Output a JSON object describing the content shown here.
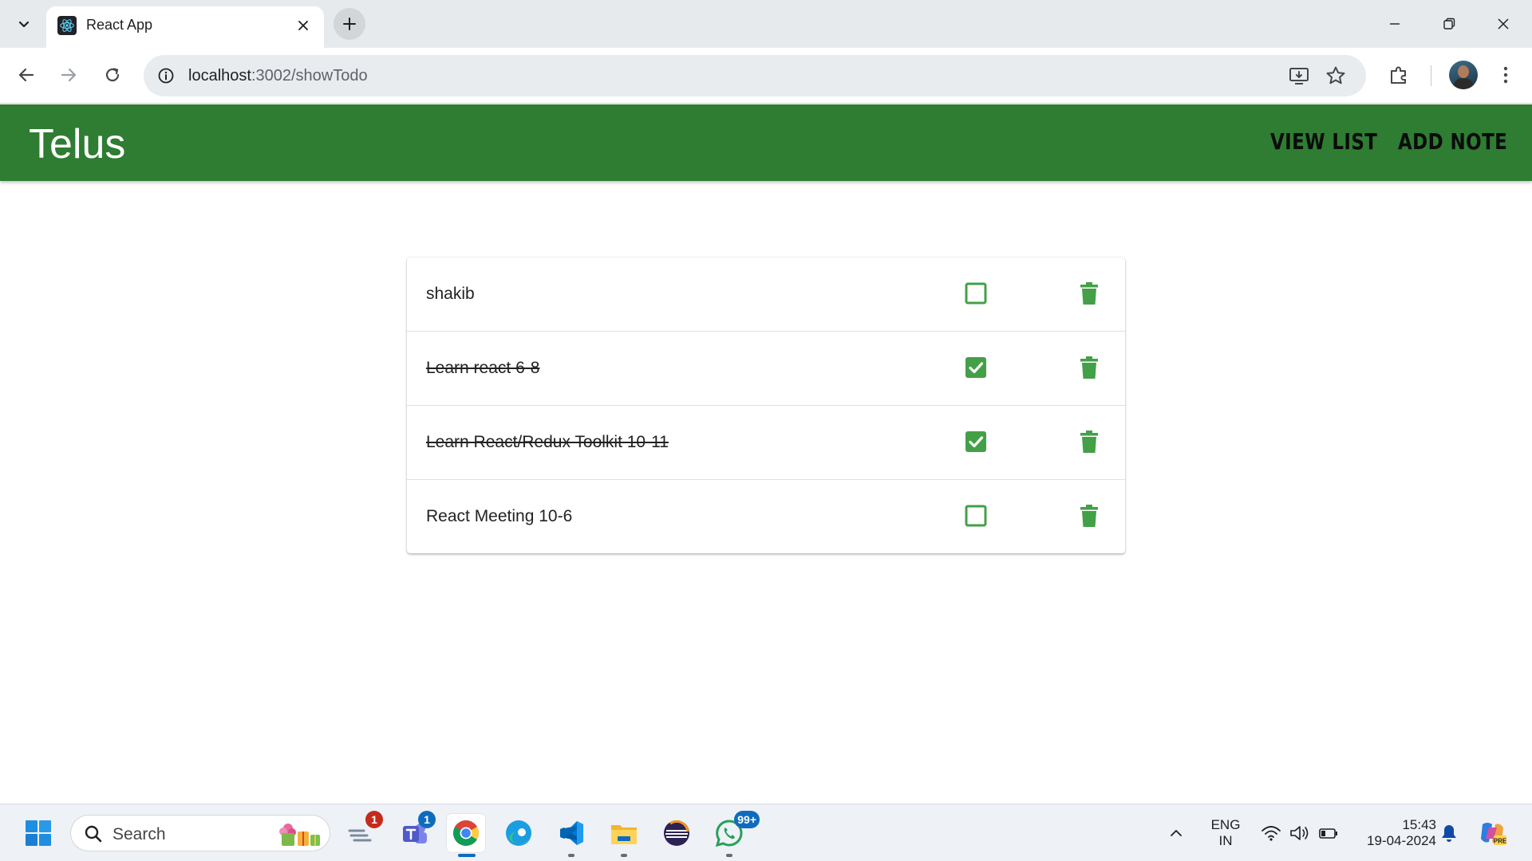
{
  "browser": {
    "tab_title": "React App",
    "url_host": "localhost",
    "url_path": ":3002/showTodo"
  },
  "app": {
    "brand": "Telus",
    "nav": [
      {
        "label": "VIEW LIST"
      },
      {
        "label": "ADD NOTE"
      }
    ],
    "accent_color": "#2e7d32",
    "icon_color": "#43a047"
  },
  "todos": [
    {
      "text": "shakib",
      "completed": false
    },
    {
      "text": "Learn react 6-8",
      "completed": true
    },
    {
      "text": "Learn React/Redux Toolkit 10-11",
      "completed": true
    },
    {
      "text": "React Meeting 10-6",
      "completed": false
    }
  ],
  "taskbar": {
    "search_placeholder": "Search",
    "badges": {
      "feedback": "1",
      "teams": "1",
      "whatsapp": "99+"
    },
    "language": "ENG",
    "region": "IN",
    "time": "15:43",
    "date": "19-04-2024"
  }
}
